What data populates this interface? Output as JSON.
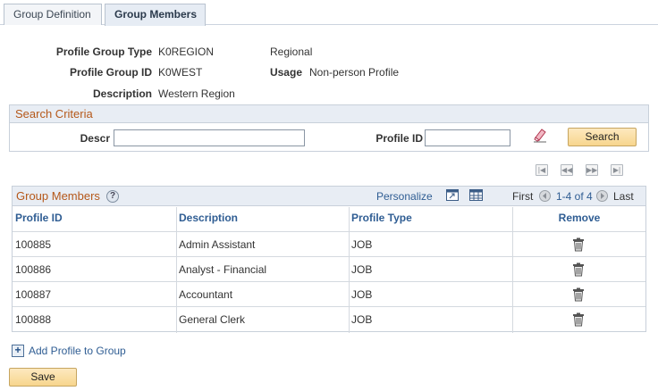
{
  "tabs": [
    {
      "label": "Group Definition",
      "active": false
    },
    {
      "label": "Group Members",
      "active": true
    }
  ],
  "header": {
    "profile_group_type_label": "Profile Group Type",
    "profile_group_type_value": "K0REGION",
    "profile_group_type_desc": "Regional",
    "profile_group_id_label": "Profile Group ID",
    "profile_group_id_value": "K0WEST",
    "usage_label": "Usage",
    "usage_value": "Non-person Profile",
    "description_label": "Description",
    "description_value": "Western Region"
  },
  "search": {
    "title": "Search Criteria",
    "descr_label": "Descr",
    "descr_value": "",
    "profile_id_label": "Profile ID",
    "profile_id_value": "",
    "search_button": "Search"
  },
  "grid": {
    "title": "Group Members",
    "personalize": "Personalize",
    "first": "First",
    "range": "1-4 of 4",
    "last": "Last",
    "columns": [
      "Profile ID",
      "Description",
      "Profile Type",
      "Remove"
    ],
    "rows": [
      {
        "profile_id": "100885",
        "description": "Admin Assistant",
        "profile_type": "JOB"
      },
      {
        "profile_id": "100886",
        "description": "Analyst - Financial",
        "profile_type": "JOB"
      },
      {
        "profile_id": "100887",
        "description": "Accountant",
        "profile_type": "JOB"
      },
      {
        "profile_id": "100888",
        "description": "General Clerk",
        "profile_type": "JOB"
      }
    ]
  },
  "add_profile_label": "Add Profile to Group",
  "save_button": "Save",
  "colors": {
    "accent_orange": "#b5581a",
    "link_blue": "#2f5d93",
    "header_bg": "#e8edf4",
    "button_bg": "#f7d58d"
  }
}
